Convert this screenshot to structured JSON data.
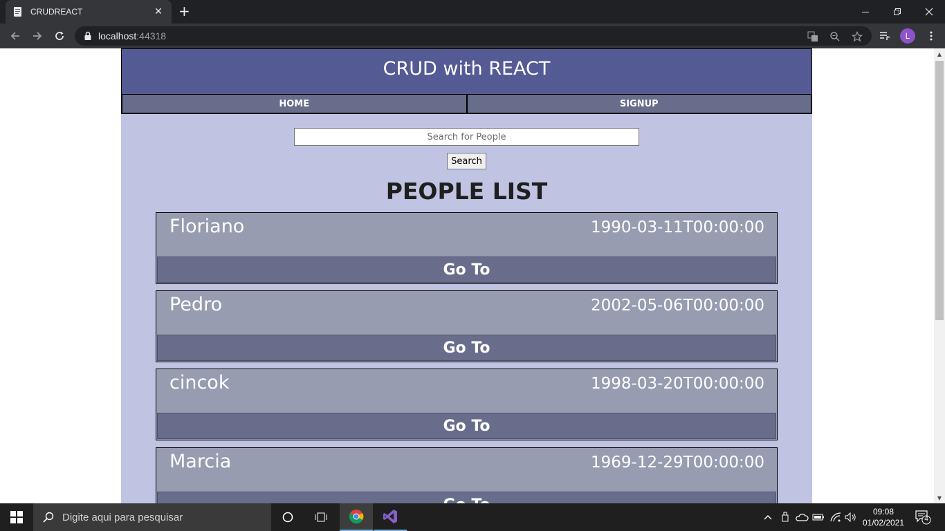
{
  "browser": {
    "tab_title": "CRUDREACT",
    "url_host": "localhost",
    "url_port": ":44318",
    "profile_initial": "L"
  },
  "app": {
    "title": "CRUD with REACT",
    "nav": [
      {
        "label": "HOME"
      },
      {
        "label": "SIGNUP"
      }
    ],
    "search": {
      "placeholder": "Search for People",
      "value": "",
      "button_label": "Search"
    },
    "list_title": "PEOPLE LIST",
    "people": [
      {
        "name": "Floriano",
        "date": "1990-03-11T00:00:00",
        "action": "Go To"
      },
      {
        "name": "Pedro",
        "date": "2002-05-06T00:00:00",
        "action": "Go To"
      },
      {
        "name": "cincok",
        "date": "1998-03-20T00:00:00",
        "action": "Go To"
      },
      {
        "name": "Marcia",
        "date": "1969-12-29T00:00:00",
        "action": "Go To"
      }
    ],
    "colors": {
      "header": "#545b94",
      "nav": "#676d8a",
      "background": "#c0c3e2",
      "card": "#979cb0"
    }
  },
  "taskbar": {
    "search_placeholder": "Digite aqui para pesquisar",
    "time": "09:08",
    "date": "01/02/2021",
    "notification_count": "4"
  }
}
